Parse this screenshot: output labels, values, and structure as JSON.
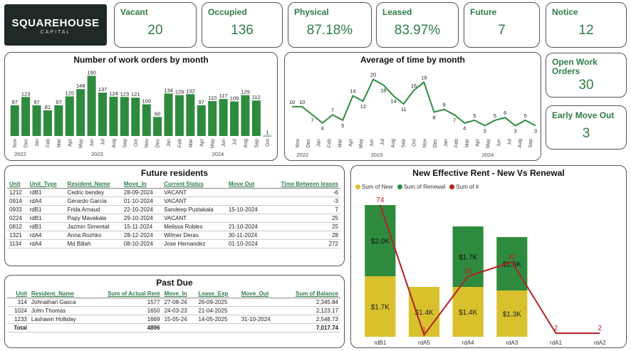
{
  "logo": {
    "line1": "SQUAREHOUSE",
    "line2": "CAPITAL"
  },
  "kpis": [
    {
      "label": "Vacant",
      "value": "20"
    },
    {
      "label": "Occupied",
      "value": "136"
    },
    {
      "label": "Physical",
      "value": "87.18%"
    },
    {
      "label": "Leased",
      "value": "83.97%"
    },
    {
      "label": "Future",
      "value": "7"
    },
    {
      "label": "Notice",
      "value": "12"
    }
  ],
  "side_kpis": [
    {
      "label": "Open Work Orders",
      "value": "30"
    },
    {
      "label": "Early Move Out",
      "value": "3"
    }
  ],
  "chart_data": [
    {
      "type": "bar",
      "title": "Number of work orders by month",
      "categories": [
        "Nov",
        "Dec",
        "Jan",
        "Feb",
        "Mar",
        "Apr",
        "May",
        "Jun",
        "Jul",
        "Aug",
        "Sep",
        "Oct",
        "Nov",
        "Dec",
        "Jan",
        "Feb",
        "Mar",
        "Apr",
        "May",
        "Jun",
        "Jul",
        "Aug",
        "Sep",
        "Oct"
      ],
      "year_labels": [
        {
          "label": "2022",
          "start": 0,
          "end": 1
        },
        {
          "label": "2023",
          "start": 2,
          "end": 13
        },
        {
          "label": "2024",
          "start": 14,
          "end": 23
        }
      ],
      "values": [
        97,
        123,
        97,
        81,
        97,
        125,
        148,
        190,
        137,
        124,
        123,
        121,
        100,
        60,
        134,
        129,
        132,
        97,
        110,
        117,
        109,
        129,
        112,
        1
      ],
      "ylim": [
        0,
        200
      ],
      "color": "#2e8b3e"
    },
    {
      "type": "line",
      "title": "Average of time by month",
      "categories": [
        "Nov",
        "Dec",
        "Jan",
        "Feb",
        "Mar",
        "Apr",
        "May",
        "Jun",
        "Jul",
        "Aug",
        "Sep",
        "Oct",
        "Nov",
        "Dec",
        "Jan",
        "Feb",
        "Mar",
        "Apr",
        "May",
        "Jun",
        "Jul",
        "Aug",
        "Sep"
      ],
      "year_labels": [
        {
          "label": "2022",
          "start": 0,
          "end": 1
        },
        {
          "label": "2023",
          "start": 2,
          "end": 13
        },
        {
          "label": "2024",
          "start": 14,
          "end": 22
        }
      ],
      "values": [
        10,
        10,
        7,
        4,
        7,
        5,
        14,
        12,
        20,
        18,
        14,
        11,
        16,
        19,
        8,
        9,
        7,
        4,
        5,
        3,
        5,
        6,
        3,
        5,
        3
      ],
      "ylim": [
        0,
        22
      ],
      "color": "#2e8b3e"
    },
    {
      "type": "bar",
      "title": "New Effective Rent - New Vs Renewal",
      "legend": [
        "Sum of New",
        "Sum of Renewal",
        "Sum of #"
      ],
      "categories": [
        "rdB1",
        "rdA5",
        "rdA4",
        "rdA3",
        "rdA1",
        "rdA2"
      ],
      "series": [
        {
          "name": "Sum of New",
          "values": [
            1700,
            1400,
            1400,
            1300,
            0,
            0
          ],
          "labels": [
            "$1.7K",
            "$1.4K",
            "$1.4K",
            "$1.3K",
            "",
            ""
          ],
          "color": "#d9c12e"
        },
        {
          "name": "Sum of Renewal",
          "values": [
            2000,
            0,
            1700,
            1500,
            0,
            0
          ],
          "labels": [
            "$2.0K",
            "",
            "$1.7K",
            "$1.5K",
            "",
            ""
          ],
          "color": "#2e8b3e"
        },
        {
          "name": "Sum of #",
          "values": [
            74,
            1,
            34,
            42,
            2,
            2
          ],
          "color": "#b22222"
        }
      ],
      "ylim": [
        0,
        4000
      ],
      "line_ylim": [
        0,
        80
      ]
    }
  ],
  "future_residents": {
    "title": "Future residents",
    "columns": [
      "Unit",
      "Unit_Type",
      "Resident_Name",
      "Move_In",
      "Current Status",
      "Move Out",
      "Time Between leases"
    ],
    "rows": [
      [
        "1212",
        "rdB1",
        "Cedric bendey",
        "28-09-2024",
        "VACANT",
        "",
        "-6"
      ],
      [
        "0914",
        "rdA4",
        "Gerardo Garcia",
        "01-10-2024",
        "VACANT",
        "",
        "-3"
      ],
      [
        "0933",
        "rdB1",
        "Frida Arnaud",
        "22-10-2024",
        "Sandeep Pustakala",
        "15-10-2024",
        "7"
      ],
      [
        "0224",
        "rdB1",
        "Papy Mavakala",
        "29-10-2024",
        "VACANT",
        "",
        "25"
      ],
      [
        "0812",
        "rdB1",
        "Jazmin Simental",
        "15-11-2024",
        "Melissa Robles",
        "21-10-2024",
        "25"
      ],
      [
        "1321",
        "rdA4",
        "Anna Rozhko",
        "28-12-2024",
        "Wilmer Deras",
        "30-11-2024",
        "28"
      ],
      [
        "1134",
        "rdA4",
        "Md Billah",
        "08-10-2024",
        "Jose Hernandez",
        "01-10-2024",
        "272"
      ]
    ]
  },
  "past_due": {
    "title": "Past Due",
    "columns": [
      "Unit",
      "Resident_Name",
      "Sum of Actual Rent",
      "Move_In",
      "Lease_Exp",
      "Move_Out",
      "Sum of Balance"
    ],
    "rows": [
      [
        "314",
        "Johnathan Gasca",
        "1577",
        "27-08-24",
        "26-09-2025",
        "",
        "2,345.84"
      ],
      [
        "1024",
        "John Thomas",
        "1650",
        "24-03-23",
        "21-04-2025",
        "",
        "2,123.17"
      ],
      [
        "1233",
        "Lashawn Holliday",
        "1669",
        "15-05-24",
        "14-05-2025",
        "31-10-2024",
        "2,548.73"
      ]
    ],
    "total": [
      "Total",
      "",
      "4896",
      "",
      "",
      "",
      "7,017.74"
    ]
  }
}
